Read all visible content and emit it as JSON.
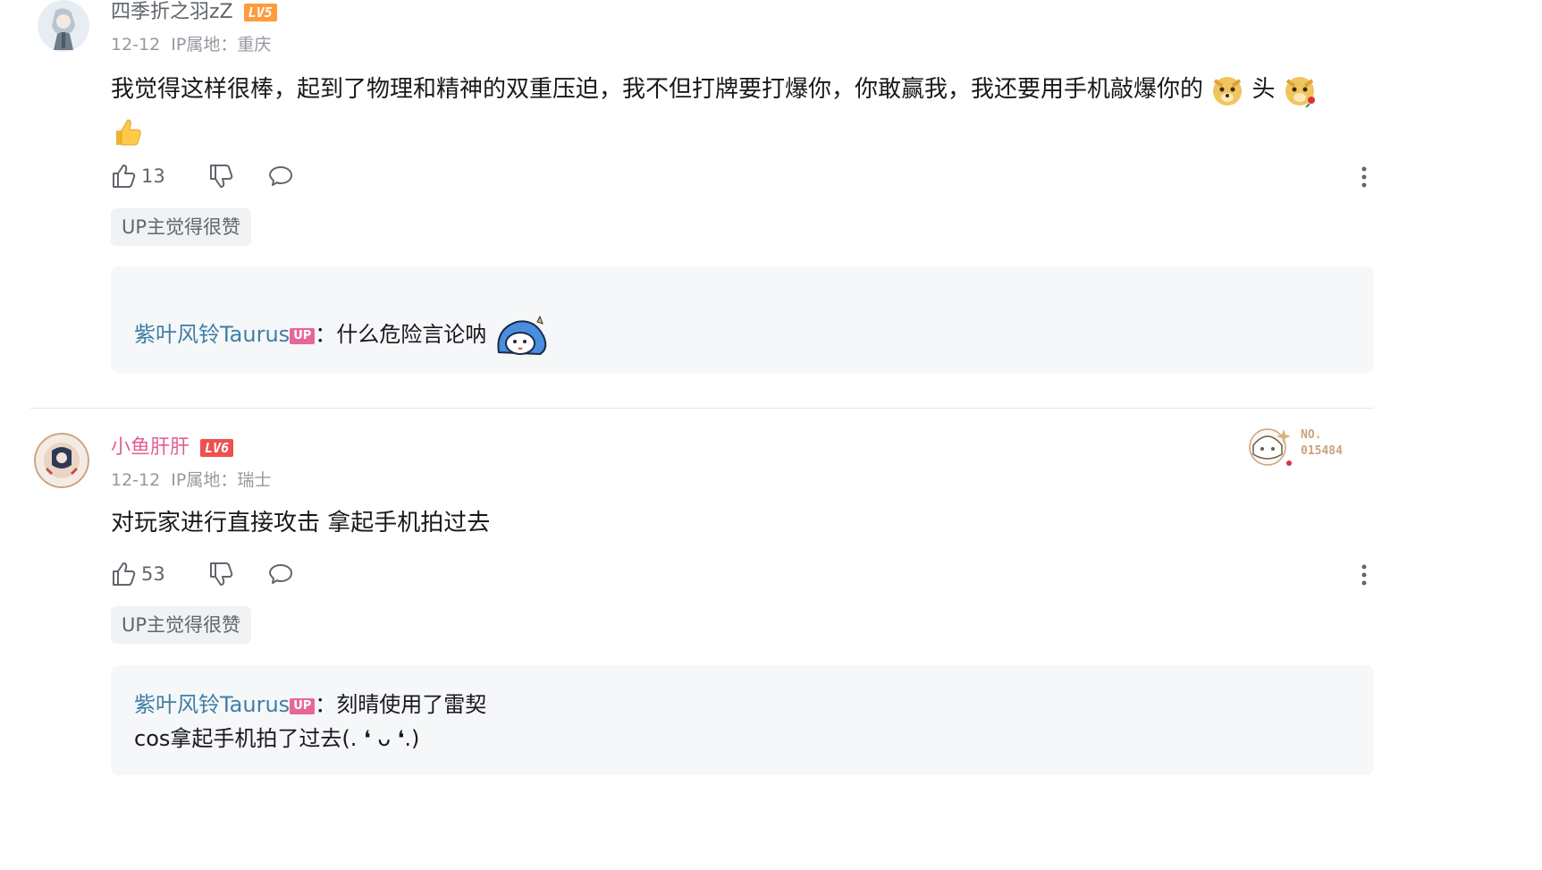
{
  "comments": [
    {
      "username": "四季折之羽zZ",
      "level": "LV5",
      "level_color": "#ff9b3d",
      "username_color": "#61666d",
      "date": "12-12",
      "ip": "IP属地：重庆",
      "content": "我觉得这样很棒，起到了物理和精神的双重压迫，我不但打牌要打爆你，你敢赢我，我还要用手机敲爆你的",
      "content_tail": "头",
      "likes": "13",
      "up_tag": "UP主觉得很赞",
      "reply": {
        "user": "紫叶风铃Taurus",
        "badge": "UP",
        "text": "：什么危险言论呐"
      }
    },
    {
      "username": "小鱼肝肝",
      "level": "LV6",
      "level_color": "#ee5050",
      "username_color": "#e35f94",
      "date": "12-12",
      "ip": "IP属地：瑞士",
      "content": "对玩家进行直接攻击 拿起手机拍过去",
      "likes": "53",
      "up_tag": "UP主觉得很赞",
      "medal": {
        "label": "NO.",
        "number": "015484"
      },
      "reply": {
        "user": "紫叶风铃Taurus",
        "badge": "UP",
        "text": "：刻晴使用了雷契",
        "text_line2": "cos拿起手机拍了过去(. ❛ ᴗ ❛.)"
      }
    }
  ],
  "icons": [
    "like-icon",
    "dislike-icon",
    "reply-icon",
    "more-icon"
  ]
}
